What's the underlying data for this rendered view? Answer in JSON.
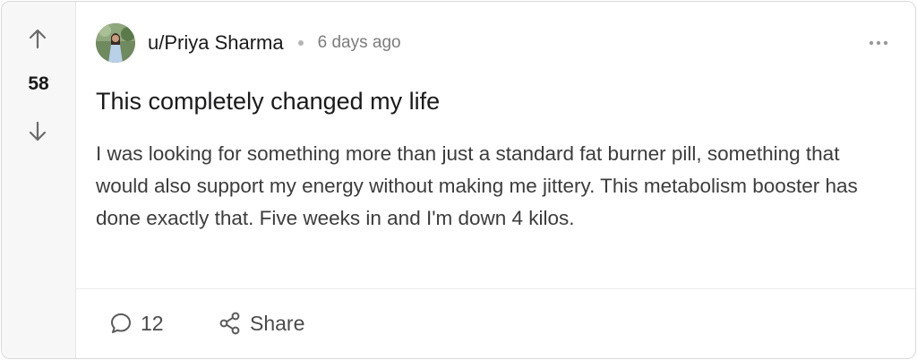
{
  "post": {
    "score": "58",
    "author": "u/Priya Sharma",
    "timestamp": "6 days ago",
    "title": "This completely changed my life",
    "body": "I was looking for something more than just a standard fat burner pill, something that would also support my energy without making me jittery. This metabolism booster has done exactly that. Five weeks in and I'm down 4 kilos.",
    "comment_count": "12",
    "share_label": "Share"
  },
  "icons": {
    "upvote": "arrow-up-icon",
    "downvote": "arrow-down-icon",
    "more": "more-horizontal-icon",
    "comment": "comment-bubble-icon",
    "share": "share-nodes-icon"
  },
  "colors": {
    "vote_column_bg": "#f7f7f7",
    "border": "#d9d9d9",
    "text_primary": "#1a1a1b",
    "text_muted": "#7c7c7c",
    "icon": "#555555"
  }
}
